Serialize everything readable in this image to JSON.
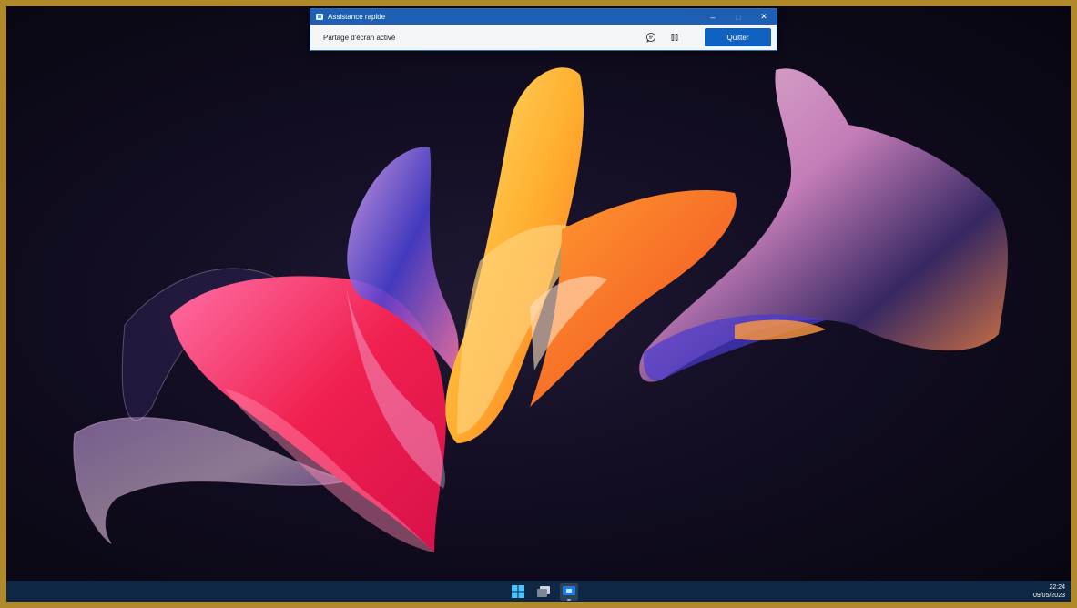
{
  "quick_assist": {
    "title": "Assistance rapide",
    "status": "Partage d'écran activé",
    "quit_label": "Quitter",
    "minimize_label": "–",
    "maximize_label": "□",
    "close_label": "✕",
    "accent": "#1f5fb3"
  },
  "taskbar": {
    "apps": [
      "start-icon",
      "task-view-icon",
      "quick-assist-app-icon"
    ],
    "time": "22:24",
    "date": "09/05/2023",
    "background": "#0e2745"
  }
}
